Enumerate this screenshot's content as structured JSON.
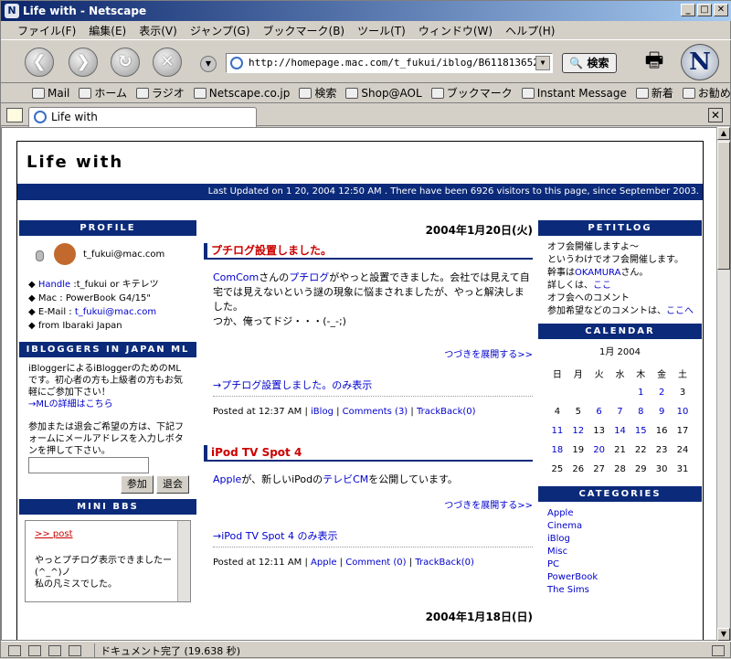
{
  "window": {
    "title": "Life with - Netscape"
  },
  "menu": [
    "ファイル(F)",
    "編集(E)",
    "表示(V)",
    "ジャンプ(G)",
    "ブックマーク(B)",
    "ツール(T)",
    "ウィンドウ(W)",
    "ヘルプ(H)"
  ],
  "toolbar": {
    "url": "http://homepage.mac.com/t_fukui/iblog/B611813652/",
    "search": "検索"
  },
  "personal": [
    "Mail",
    "ホーム",
    "ラジオ",
    "Netscape.co.jp",
    "検索",
    "Shop@AOL",
    "ブックマーク",
    "Instant Message",
    "新着",
    "お勧め"
  ],
  "tab": {
    "label": "Life with"
  },
  "status": {
    "text": "ドキュメント完了 (19.638 秒)"
  },
  "page": {
    "title": "Life with",
    "updated": "Last Updated on 1 20, 2004 12:50 AM . There have been 6926 visitors to this page, since September 2003.",
    "profile": {
      "header": "PROFILE",
      "email": "t_fukui@mac.com",
      "handle_label": "Handle",
      "handle_value": ":t_fukui or キテレツ",
      "mac": "Mac : PowerBook G4/15\"",
      "email_label": "E-Mail",
      "email_value": "t_fukui@mac.com",
      "from": "from Ibaraki Japan"
    },
    "ml": {
      "header": "IBLOGGERS IN JAPAN ML",
      "desc": "iBloggerによるiBloggerのためのMLです。初心者の方も上級者の方もお気軽にご参加下さい！",
      "link": "→MLの詳細はこちら",
      "note": "参加または退会ご希望の方は、下記フォームにメールアドレスを入力しボタンを押して下さい。",
      "join": "参加",
      "leave": "退会"
    },
    "bbs": {
      "header": "MINI BBS",
      "post": ">> post",
      "line1": "やっとプチログ表示できましたー",
      "line2": "(^_^)ノ",
      "line3": "私の凡ミスでした。"
    },
    "posts": [
      {
        "date": "2004年1月20日(火)",
        "title": "プチログ設置しました。",
        "b1": "ComCom",
        "b2": "さんの",
        "b3": "プチログ",
        "b4": "がやっと設置できました。会社では見えて自宅では見えないという謎の現象に悩まされましたが、やっと解決しました。",
        "b5": "つか、俺ってドジ・・・(-_-;)",
        "more": "つづきを展開する>>",
        "only": "→プチログ設置しました。のみ表示",
        "meta_time": "Posted at 12:37 AM",
        "meta_cat": "iBlog",
        "meta_comments": "Comments (3)",
        "meta_tb": "TrackBack(0)"
      },
      {
        "title": "iPod TV Spot 4",
        "b1": "Apple",
        "b2": "が、新しいiPodの",
        "b3": "テレビCM",
        "b4": "を公開しています。",
        "more": "つづきを展開する>>",
        "only": "→iPod TV Spot 4 のみ表示",
        "meta_time": "Posted at 12:11 AM",
        "meta_cat": "Apple",
        "meta_comments": "Comment (0)",
        "meta_tb": "TrackBack(0)"
      }
    ],
    "next_date": "2004年1月18日(日)",
    "petitlog": {
      "header": "PETITLOG",
      "l1": "オフ会開催しますよ～",
      "l2": "というわけでオフ会開催します。",
      "l3a": "幹事は",
      "l3b": "OKAMURA",
      "l3c": "さん。",
      "l4a": "詳しくは、",
      "l4b": "ここ",
      "l5": "オフ会へのコメント",
      "l6a": "参加希望などのコメントは、",
      "l6b": "ここへ"
    },
    "calendar": {
      "header": "CALENDAR",
      "month": "1月 2004",
      "days": [
        "日",
        "月",
        "火",
        "水",
        "木",
        "金",
        "土"
      ],
      "weeks": [
        [
          "",
          "",
          "",
          "",
          "1",
          "2",
          "3"
        ],
        [
          "4",
          "5",
          "6",
          "7",
          "8",
          "9",
          "10"
        ],
        [
          "11",
          "12",
          "13",
          "14",
          "15",
          "16",
          "17"
        ],
        [
          "18",
          "19",
          "20",
          "21",
          "22",
          "23",
          "24"
        ],
        [
          "25",
          "26",
          "27",
          "28",
          "29",
          "30",
          "31"
        ]
      ],
      "linked": [
        "1",
        "2",
        "6",
        "7",
        "8",
        "9",
        "10",
        "11",
        "12",
        "14",
        "15",
        "18",
        "20"
      ]
    },
    "categories": {
      "header": "CATEGORIES",
      "items": [
        "Apple",
        "Cinema",
        "iBlog",
        "Misc",
        "PC",
        "PowerBook",
        "The Sims"
      ]
    }
  }
}
